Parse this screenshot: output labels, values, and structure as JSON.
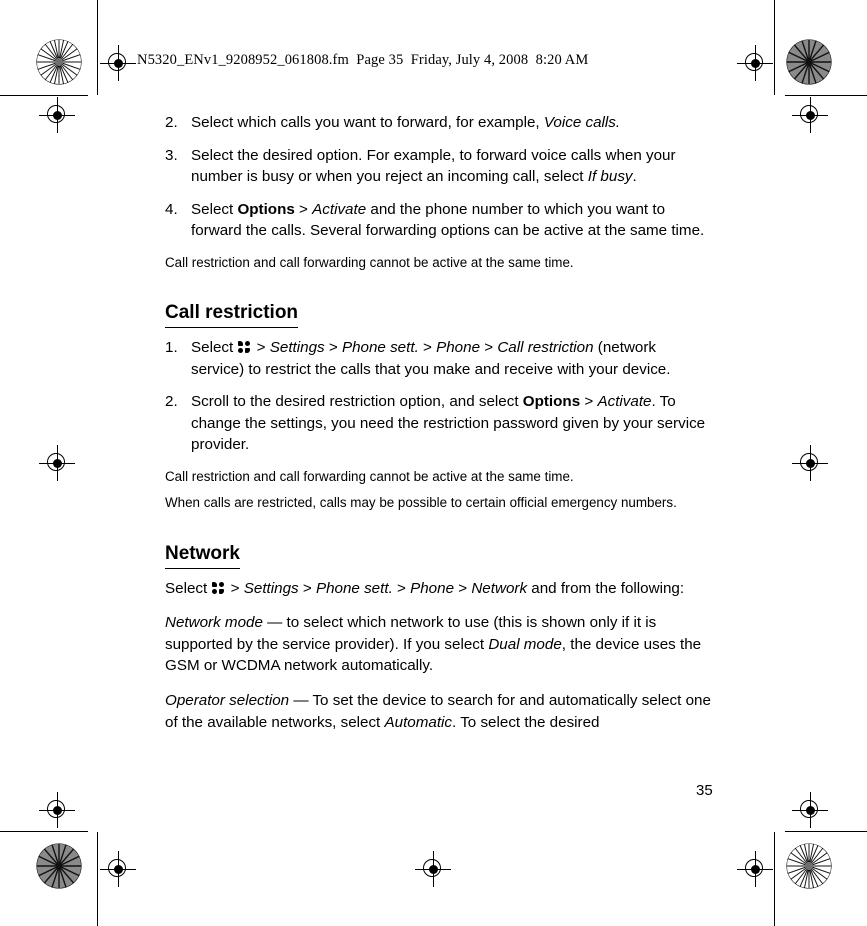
{
  "page": {
    "file_header": "N5320_ENv1_9208952_061808.fm  Page 35  Friday, July 4, 2008  8:20 AM",
    "page_number": "35",
    "ink_color": "#000000",
    "paper_color": "#ffffff"
  },
  "call_forwarding_steps": [
    {
      "num": "2.",
      "parts": [
        {
          "text": "Select which calls you want to forward, for example, ",
          "style": "normal"
        },
        {
          "text": "Voice calls.",
          "style": "italic"
        }
      ]
    },
    {
      "num": "3.",
      "parts": [
        {
          "text": "Select the desired option. For example, to forward voice calls when your number is busy or when you reject an incoming call, select ",
          "style": "normal"
        },
        {
          "text": "If busy",
          "style": "italic"
        },
        {
          "text": ".",
          "style": "normal"
        }
      ]
    },
    {
      "num": "4.",
      "parts": [
        {
          "text": "Select ",
          "style": "normal"
        },
        {
          "text": "Options",
          "style": "bold"
        },
        {
          "text": " > ",
          "style": "normal"
        },
        {
          "text": "Activate",
          "style": "italic"
        },
        {
          "text": " and the phone number to which you want to forward the calls. Several forwarding options can be active at the same time.",
          "style": "normal"
        }
      ]
    }
  ],
  "note_forwarding": "Call restriction and call forwarding cannot be active at the same time.",
  "call_restriction": {
    "heading": "Call restriction",
    "steps": [
      {
        "num": "1.",
        "parts": [
          {
            "text": "Select ",
            "style": "normal"
          },
          {
            "text": "menu-grid-icon",
            "style": "icon"
          },
          {
            "text": " > ",
            "style": "normal"
          },
          {
            "text": "Settings",
            "style": "italic"
          },
          {
            "text": " > ",
            "style": "normal"
          },
          {
            "text": "Phone sett.",
            "style": "italic"
          },
          {
            "text": " > ",
            "style": "normal"
          },
          {
            "text": "Phone",
            "style": "italic"
          },
          {
            "text": " > ",
            "style": "normal"
          },
          {
            "text": "Call restriction",
            "style": "italic"
          },
          {
            "text": " (network service) to restrict the calls that you make and receive with your device.",
            "style": "normal"
          }
        ]
      },
      {
        "num": "2.",
        "parts": [
          {
            "text": "Scroll to the desired restriction option, and select ",
            "style": "normal"
          },
          {
            "text": "Options",
            "style": "bold"
          },
          {
            "text": " > ",
            "style": "normal"
          },
          {
            "text": "Activate",
            "style": "italic"
          },
          {
            "text": ". To change the settings, you need the restriction password given by your service provider.",
            "style": "normal"
          }
        ]
      }
    ],
    "note_1": "Call restriction and call forwarding cannot be active at the same time.",
    "note_2": "When calls are restricted, calls may be possible to certain official emergency numbers."
  },
  "network": {
    "heading": "Network",
    "intro_parts": [
      {
        "text": "Select ",
        "style": "normal"
      },
      {
        "text": "menu-grid-icon",
        "style": "icon"
      },
      {
        "text": " > ",
        "style": "normal"
      },
      {
        "text": "Settings",
        "style": "italic"
      },
      {
        "text": " > ",
        "style": "normal"
      },
      {
        "text": "Phone sett.",
        "style": "italic"
      },
      {
        "text": " > ",
        "style": "normal"
      },
      {
        "text": "Phone",
        "style": "italic"
      },
      {
        "text": " > ",
        "style": "normal"
      },
      {
        "text": "Network",
        "style": "italic"
      },
      {
        "text": " and from the following:",
        "style": "normal"
      }
    ],
    "entries": [
      {
        "parts": [
          {
            "text": "Network mode",
            "style": "italic"
          },
          {
            "text": " — to select which network to use (this is shown only if it is supported by the service provider). If you select ",
            "style": "normal"
          },
          {
            "text": "Dual mode",
            "style": "italic"
          },
          {
            "text": ", the device uses the GSM or WCDMA network automatically.",
            "style": "normal"
          }
        ]
      },
      {
        "parts": [
          {
            "text": "Operator selection",
            "style": "italic"
          },
          {
            "text": " — To set the device to search for and automatically select one of the available networks, select ",
            "style": "normal"
          },
          {
            "text": "Automatic",
            "style": "italic"
          },
          {
            "text": ". To select the desired",
            "style": "normal"
          }
        ]
      }
    ]
  },
  "printer_marks": {
    "starburst_label": "starburst-target",
    "crosshair_label": "registration-crosshair",
    "crop_line_label": "crop-mark-line"
  }
}
